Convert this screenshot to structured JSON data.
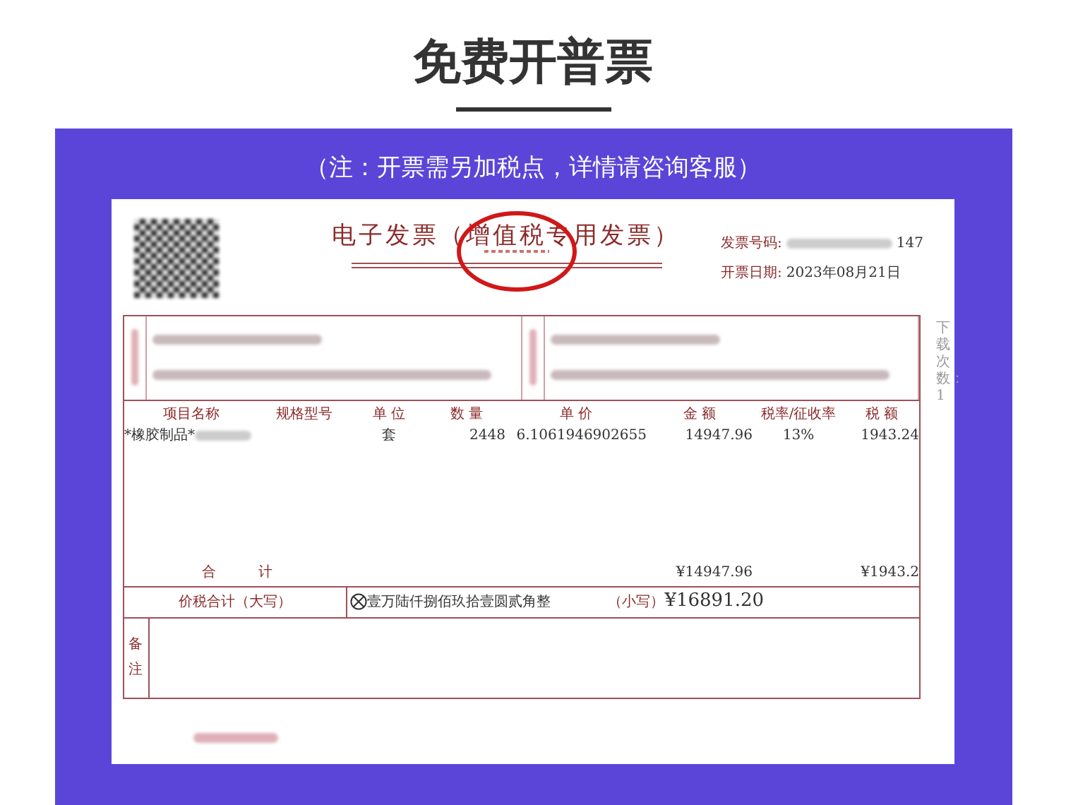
{
  "heading": "免费开普票",
  "note": "（注：开票需另加税点，详情请咨询客服）",
  "invoice": {
    "title": "电子发票（增值税专用发票）",
    "number_label": "发票号码:",
    "number_tail": "147",
    "date_label": "开票日期:",
    "date": "2023年08月21日",
    "side_text": "下载次数：1",
    "columns": [
      "项目名称",
      "规格型号",
      "单 位",
      "数 量",
      "单 价",
      "金 额",
      "税率/征收率",
      "税 额"
    ],
    "rows": [
      {
        "name": "*橡胶制品*",
        "unit": "套",
        "quantity": "2448",
        "price": "6.1061946902655",
        "amount": "14947.96",
        "rate": "13%",
        "tax": "1943.24"
      }
    ],
    "total_label": "合　　　计",
    "total_amount": "¥14947.96",
    "total_tax": "¥1943.2",
    "grand_label": "价税合计（大写）",
    "grand_words": "壹万陆仟捌佰玖拾壹圆贰角整",
    "grand_small_label": "（小写）",
    "grand_small": "¥16891.20",
    "remarks_label": "备注"
  }
}
